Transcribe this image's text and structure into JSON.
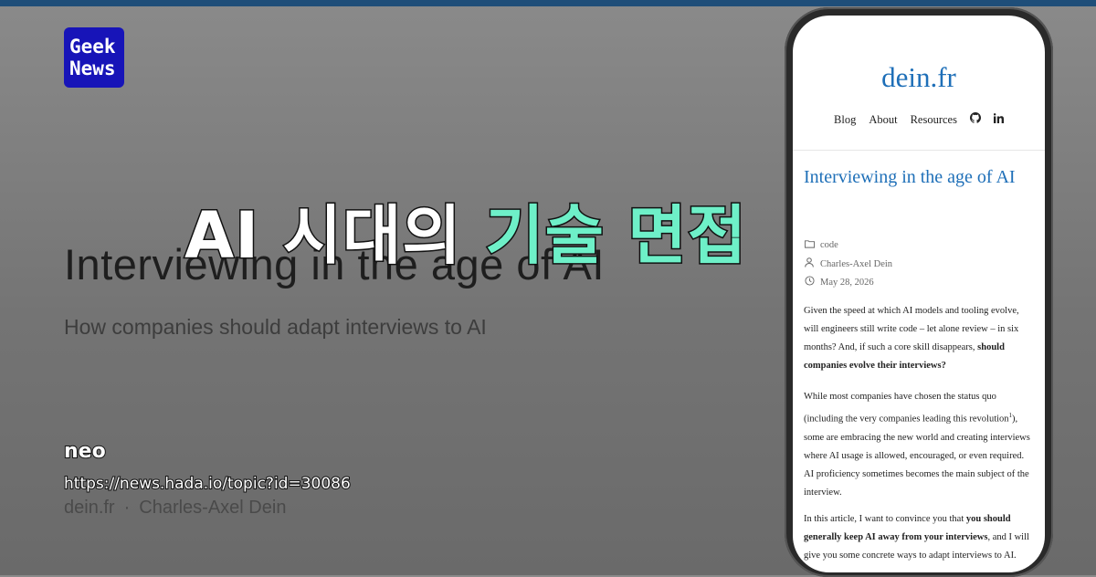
{
  "logo": {
    "line1": "Geek",
    "line2": "News"
  },
  "background": {
    "title": "Interviewing  in the age of AI",
    "subtitle": "How companies should adapt interviews  to AI",
    "site": "dein.fr",
    "separator": "·",
    "site_author": "Charles-Axel  Dein"
  },
  "overlay": {
    "ko_title_part1": "AI 시대의 ",
    "ko_title_highlight": "기술 면접",
    "author": "neo",
    "url": "https://news.hada.io/topic?id=30086"
  },
  "phone": {
    "brand": "dein.fr",
    "nav": [
      "Blog",
      "About",
      "Resources"
    ],
    "nav_icons": [
      "github-icon",
      "linkedin-icon"
    ],
    "post_title": "Interviewing in the age of AI",
    "category": "code",
    "author": "Charles-Axel Dein",
    "date": "May 28, 2026",
    "p1_a": "Given the speed at which AI models and tooling evolve, will engineers still write code – let alone review – in six months? And, if such a core skill disappears, ",
    "p1_b": "should companies evolve their interviews?",
    "p2_a": "While most companies have chosen the status quo (including the very companies leading this revolution",
    "p2_sup": "1",
    "p2_b": "), some are embracing the new world and creating interviews where AI usage is allowed, encouraged, or even required. AI proficiency sometimes becomes the main subject of the interview.",
    "p3_a": "In this article, I want to convince you that ",
    "p3_b": "you should generally keep AI away from your interviews",
    "p3_c": ", and I will give you some concrete ways to adapt interviews to AI."
  },
  "colors": {
    "accent_blue": "#1e6fb8",
    "highlight_green": "#6ef0c8",
    "logo_bg": "#1714b8",
    "top_bar": "#1f4e79"
  }
}
